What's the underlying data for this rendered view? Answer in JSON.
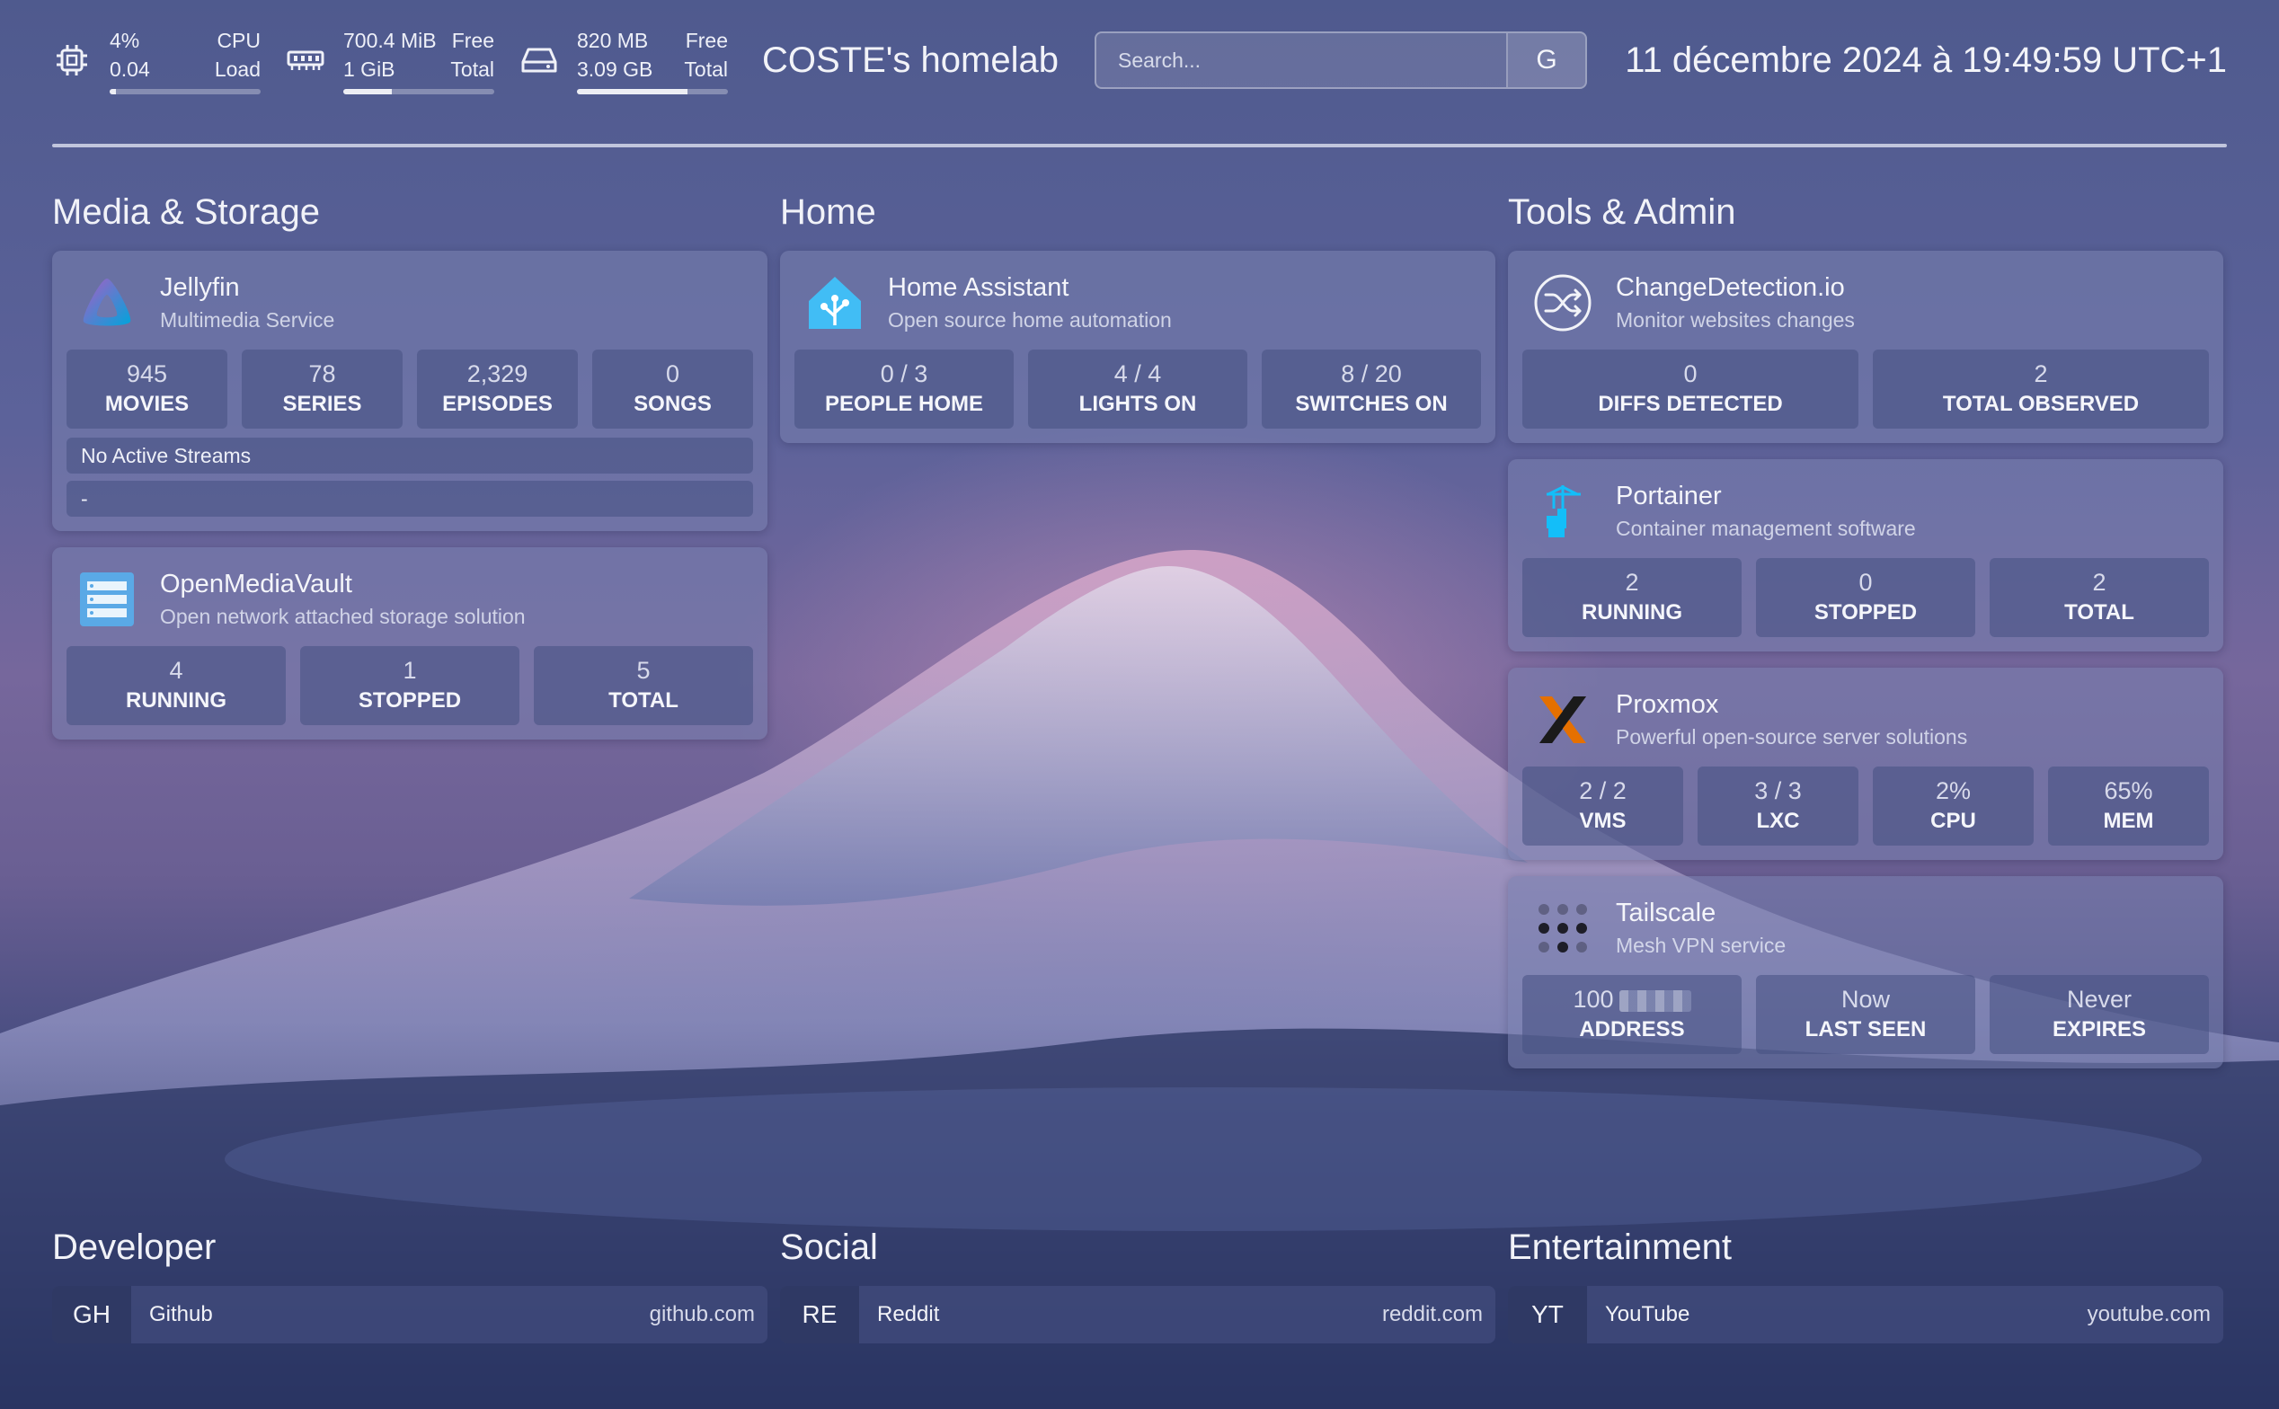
{
  "header": {
    "cpu": {
      "top_value": "4%",
      "top_label": "CPU",
      "bottom_value": "0.04",
      "bottom_label": "Load",
      "usage_fraction": 0.04
    },
    "memory": {
      "top_value": "700.4 MiB",
      "top_label": "Free",
      "bottom_value": "1 GiB",
      "bottom_label": "Total",
      "usage_fraction": 0.32
    },
    "disk": {
      "top_value": "820 MB",
      "top_label": "Free",
      "bottom_value": "3.09 GB",
      "bottom_label": "Total",
      "usage_fraction": 0.73
    },
    "site_title": "COSTE's homelab",
    "search": {
      "placeholder": "Search...",
      "engine_label": "G"
    },
    "datetime": "11 décembre 2024 à 19:49:59 UTC+1"
  },
  "columns": [
    {
      "title": "Media & Storage",
      "services": [
        {
          "name": "Jellyfin",
          "description": "Multimedia Service",
          "icon": "jellyfin-icon",
          "stats": [
            {
              "value": "945",
              "label": "MOVIES"
            },
            {
              "value": "78",
              "label": "SERIES"
            },
            {
              "value": "2,329",
              "label": "EPISODES"
            },
            {
              "value": "0",
              "label": "SONGS"
            }
          ],
          "streams": [
            "No Active Streams",
            "-"
          ]
        },
        {
          "name": "OpenMediaVault",
          "description": "Open network attached storage solution",
          "icon": "openmediavault-icon",
          "stats": [
            {
              "value": "4",
              "label": "RUNNING"
            },
            {
              "value": "1",
              "label": "STOPPED"
            },
            {
              "value": "5",
              "label": "TOTAL"
            }
          ]
        }
      ]
    },
    {
      "title": "Home",
      "services": [
        {
          "name": "Home Assistant",
          "description": "Open source home automation",
          "icon": "home-assistant-icon",
          "stats": [
            {
              "value": "0 / 3",
              "label": "PEOPLE HOME"
            },
            {
              "value": "4 / 4",
              "label": "LIGHTS ON"
            },
            {
              "value": "8 / 20",
              "label": "SWITCHES ON"
            }
          ]
        }
      ]
    },
    {
      "title": "Tools & Admin",
      "services": [
        {
          "name": "ChangeDetection.io",
          "description": "Monitor websites changes",
          "icon": "changedetection-icon",
          "stats": [
            {
              "value": "0",
              "label": "DIFFS DETECTED"
            },
            {
              "value": "2",
              "label": "TOTAL OBSERVED"
            }
          ]
        },
        {
          "name": "Portainer",
          "description": "Container management software",
          "icon": "portainer-icon",
          "stats": [
            {
              "value": "2",
              "label": "RUNNING"
            },
            {
              "value": "0",
              "label": "STOPPED"
            },
            {
              "value": "2",
              "label": "TOTAL"
            }
          ]
        },
        {
          "name": "Proxmox",
          "description": "Powerful open-source server solutions",
          "icon": "proxmox-icon",
          "stats": [
            {
              "value": "2 / 2",
              "label": "VMS"
            },
            {
              "value": "3 / 3",
              "label": "LXC"
            },
            {
              "value": "2%",
              "label": "CPU"
            },
            {
              "value": "65%",
              "label": "MEM"
            }
          ]
        },
        {
          "name": "Tailscale",
          "description": "Mesh VPN service",
          "icon": "tailscale-icon",
          "stats": [
            {
              "value": "100",
              "label": "ADDRESS"
            },
            {
              "value": "Now",
              "label": "LAST SEEN"
            },
            {
              "value": "Never",
              "label": "EXPIRES"
            }
          ]
        }
      ]
    }
  ],
  "bookmarks": [
    {
      "title": "Developer",
      "items": [
        {
          "abbr": "GH",
          "name": "Github",
          "url": "github.com"
        }
      ]
    },
    {
      "title": "Social",
      "items": [
        {
          "abbr": "RE",
          "name": "Reddit",
          "url": "reddit.com"
        }
      ]
    },
    {
      "title": "Entertainment",
      "items": [
        {
          "abbr": "YT",
          "name": "YouTube",
          "url": "youtube.com"
        }
      ]
    }
  ]
}
